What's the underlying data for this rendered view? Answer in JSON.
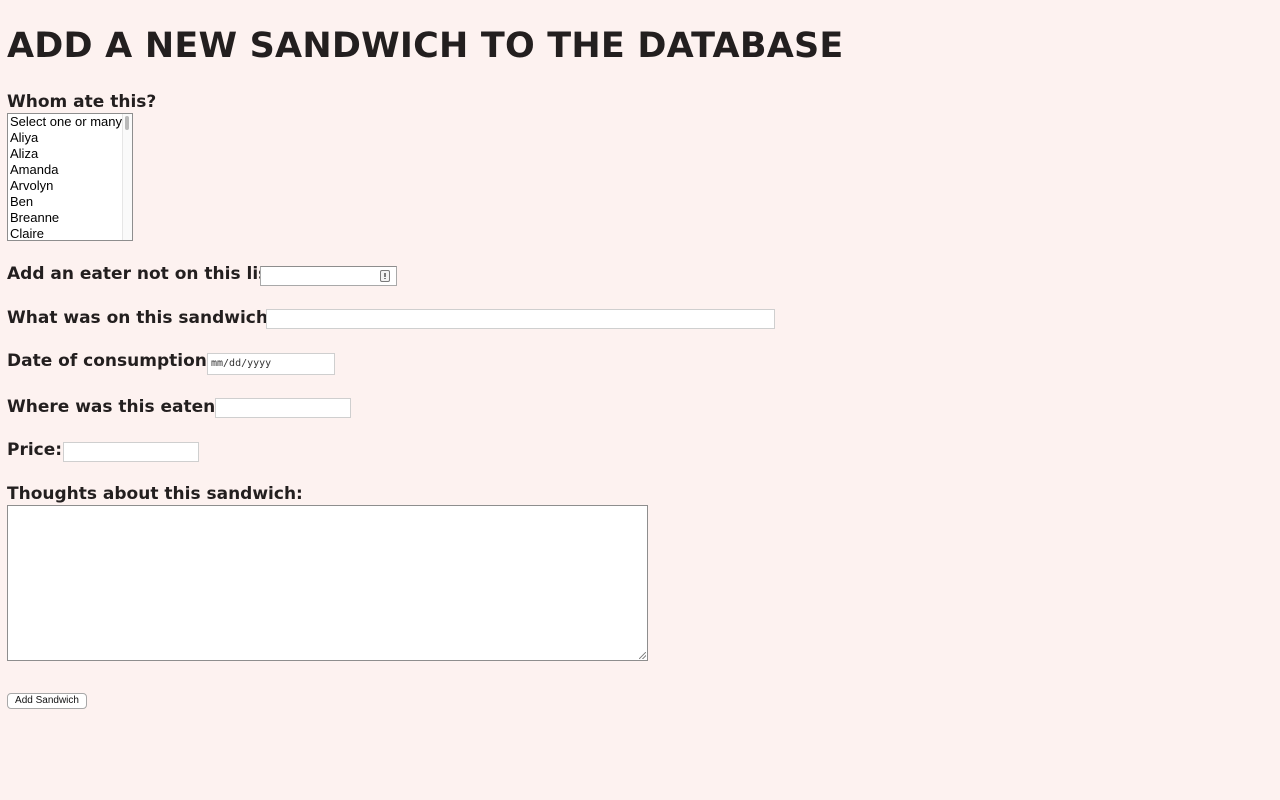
{
  "page": {
    "title": "ADD A NEW SANDWICH TO THE DATABASE"
  },
  "eaters": {
    "label": "Whom ate this?",
    "options": [
      "Select one or many",
      "Aliya",
      "Aliza",
      "Amanda",
      "Arvolyn",
      "Ben",
      "Breanne",
      "Claire"
    ]
  },
  "new_eater": {
    "label": "Add an eater not on this list",
    "value": "",
    "icon": "contact-card-icon"
  },
  "contents": {
    "label": "What was on this sandwich?",
    "value": ""
  },
  "date": {
    "label": "Date of consumption:",
    "placeholder": "mm/dd/yyyy"
  },
  "location": {
    "label": "Where was this eaten?",
    "value": ""
  },
  "price": {
    "label": "Price:",
    "value": ""
  },
  "thoughts": {
    "label": "Thoughts about this sandwich:",
    "value": ""
  },
  "submit": {
    "label": "Add Sandwich"
  },
  "colors": {
    "background": "#fdf2f0",
    "text": "#231f1f"
  }
}
